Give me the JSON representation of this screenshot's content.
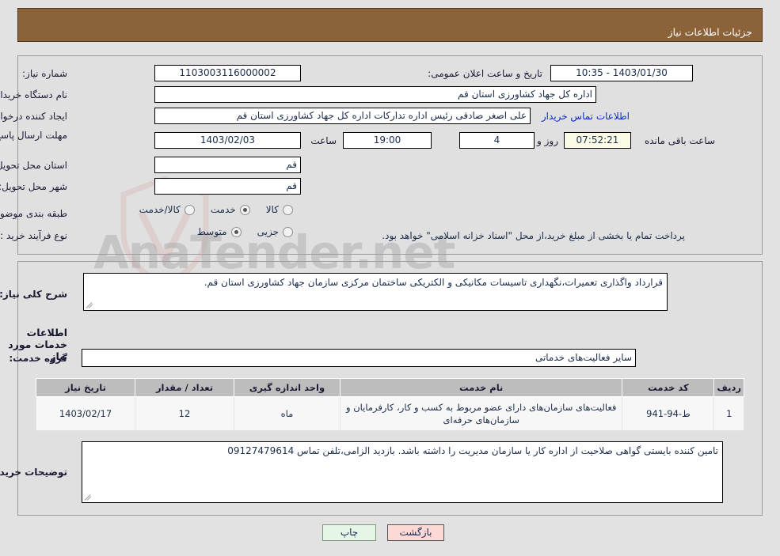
{
  "header": {
    "title": "جزئیات اطلاعات نیاز"
  },
  "watermark": {
    "text": "AnaTender.net"
  },
  "form": {
    "need_number_label": "شماره نیاز:",
    "need_number_value": "1103003116000002",
    "public_announce_label": "تاریخ و ساعت اعلان عمومی:",
    "public_announce_value": "1403/01/30 - 10:35",
    "buyer_org_label": "نام دستگاه خریدار:",
    "buyer_org_value": "اداره کل جهاد کشاورزی استان قم",
    "creator_label": "ایجاد کننده درخواست:",
    "creator_value": "علی اصغر صادقی رئیس اداره تدارکات اداره کل جهاد کشاورزی استان قم",
    "buyer_contact_link": "اطلاعات تماس خریدار",
    "deadline_label": "مهلت ارسال پاسخ: تا تاریخ:",
    "deadline_date": "1403/02/03",
    "hour_label": "ساعت",
    "hour_value": "19:00",
    "days_value": "4",
    "days_label": "روز و",
    "remaining_time": "07:52:21",
    "remaining_label": "ساعت باقی مانده",
    "province_label": "استان محل تحویل:",
    "province_value": "قم",
    "city_label": "شهر محل تحویل:",
    "city_value": "قم",
    "category_label": "طبقه بندی موضوعی:",
    "category_options": [
      {
        "label": "کالا",
        "selected": false
      },
      {
        "label": "خدمت",
        "selected": true
      },
      {
        "label": "کالا/خدمت",
        "selected": false
      }
    ],
    "purchase_type_label": "نوع فرآیند خرید :",
    "purchase_options": [
      {
        "label": "جزیی",
        "selected": false
      },
      {
        "label": "متوسط",
        "selected": true
      }
    ],
    "purchase_note": "پرداخت تمام یا بخشی از مبلغ خرید،از محل \"اسناد خزانه اسلامی\" خواهد بود."
  },
  "details": {
    "general_desc_label": "شرح کلی نیاز:",
    "general_desc_value": "قرارداد واگذاری تعمیرات،نگهداری تاسیسات مکانیکی و الکتریکی ساختمان مرکزی  سازمان جهاد کشاورزی استان قم.",
    "services_section_title": "اطلاعات خدمات مورد نیاز",
    "service_group_label": "گروه خدمت:",
    "service_group_value": "سایر فعالیت‌های خدماتی",
    "buyer_notes_label": "توضیحات خریدار:",
    "buyer_notes_value": "تامین کننده بایستی گواهی صلاحیت از اداره کار یا سازمان مدیریت را داشته باشد. بازدید الزامی،تلفن تماس 09127479614"
  },
  "table": {
    "columns": [
      "ردیف",
      "کد خدمت",
      "نام خدمت",
      "واحد اندازه گیری",
      "تعداد / مقدار",
      "تاریخ نیاز"
    ],
    "rows": [
      {
        "row": "1",
        "code": "ط-94-941",
        "name": "فعالیت‌های سازمان‌های دارای عضو مربوط به کسب و کار، کارفرمایان و سازمان‌های حرفه‌ای",
        "unit": "ماه",
        "qty": "12",
        "date": "1403/02/17"
      }
    ]
  },
  "buttons": {
    "print": "چاپ",
    "back": "بازگشت"
  }
}
